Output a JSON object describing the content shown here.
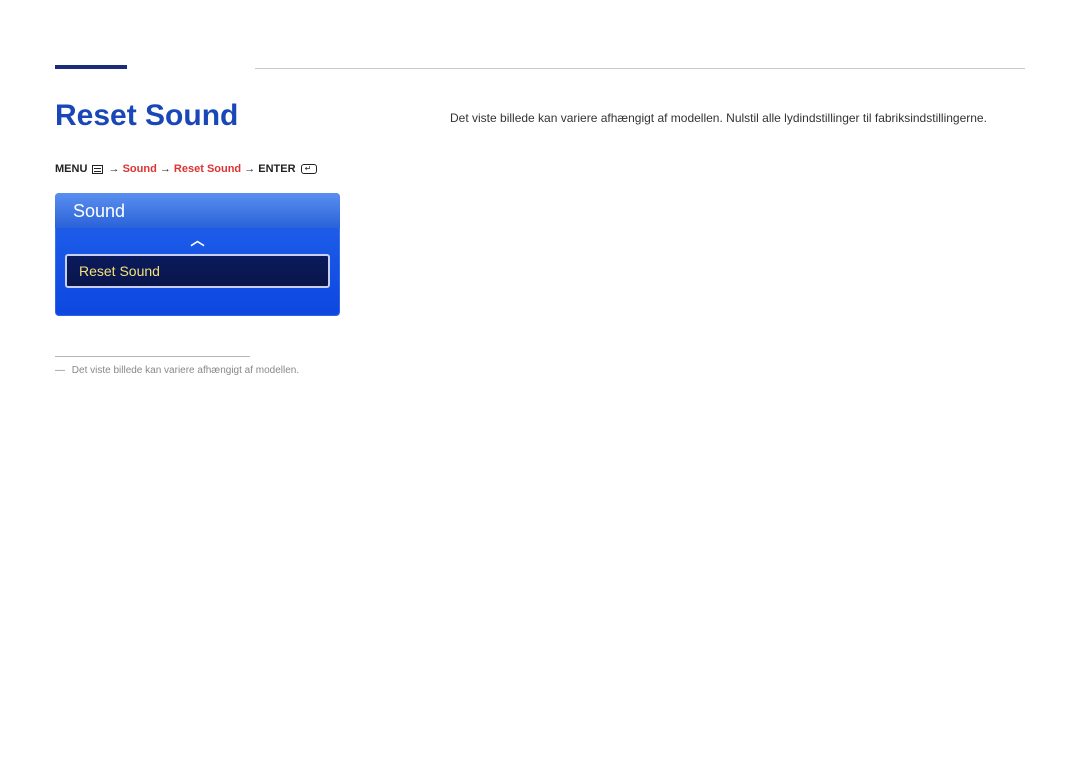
{
  "title": "Reset Sound",
  "breadcrumb": {
    "menu_label": "MENU",
    "arrow": "→",
    "sound_label": "Sound",
    "reset_sound_label": "Reset Sound",
    "enter_label": "ENTER"
  },
  "osd": {
    "header": "Sound",
    "selected_item": "Reset Sound"
  },
  "footnote": {
    "dash": "―",
    "text": "Det viste billede kan variere afhængigt af modellen."
  },
  "body_text": "Det viste billede kan variere afhængigt af modellen. Nulstil alle lydindstillinger til fabriksindstillingerne."
}
